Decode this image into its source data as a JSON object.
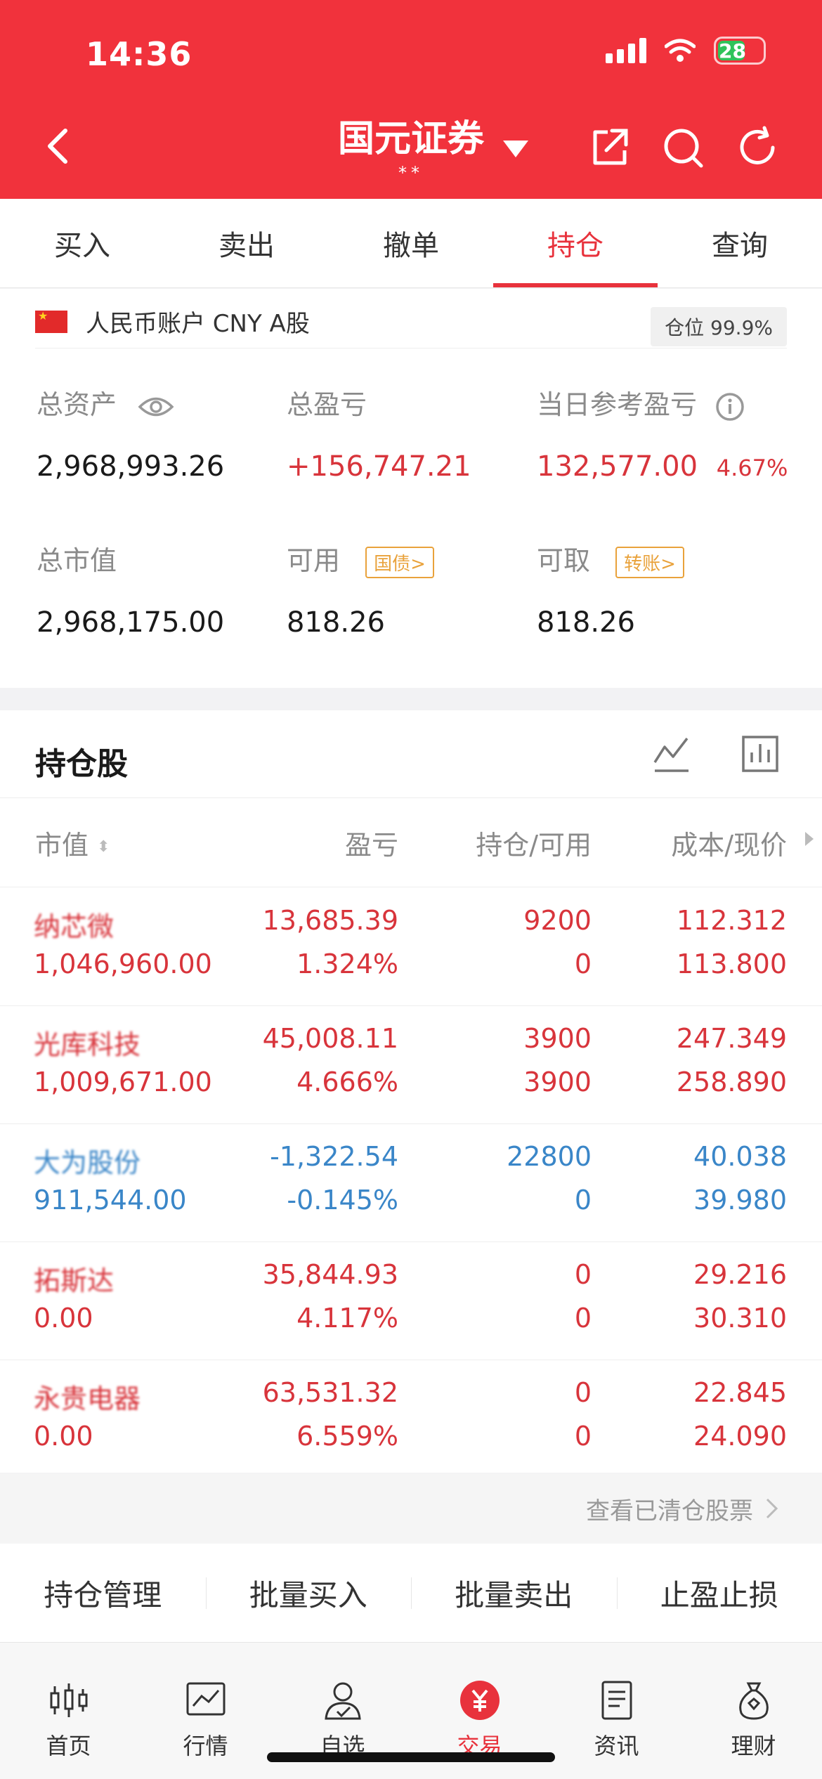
{
  "status": {
    "time": "14:36",
    "battery": "28"
  },
  "header": {
    "title": "国元证券",
    "subtitle": "**"
  },
  "tabs": [
    "买入",
    "卖出",
    "撤单",
    "持仓",
    "查询"
  ],
  "account": {
    "label": "人民币账户 CNY A股",
    "position_label": "仓位",
    "position_value": "99.9%"
  },
  "metrics": {
    "total_assets_label": "总资产",
    "total_assets": "2,968,993.26",
    "total_pl_label": "总盈亏",
    "total_pl": "+156,747.21",
    "daily_pl_label": "当日参考盈亏",
    "daily_pl": "132,577.00",
    "daily_pl_pct": "4.67%",
    "market_value_label": "总市值",
    "market_value": "2,968,175.00",
    "available_label": "可用",
    "available_badge": "国债>",
    "available": "818.26",
    "withdrawable_label": "可取",
    "withdrawable_badge": "转账>",
    "withdrawable": "818.26"
  },
  "holdings": {
    "title": "持仓股",
    "headers": {
      "market_value": "市值",
      "pl": "盈亏",
      "position": "持仓/可用",
      "cost": "成本/现价"
    },
    "rows": [
      {
        "name": "纳芯微",
        "market_value": "1,046,960.00",
        "pl": "13,685.39",
        "pl_pct": "1.324%",
        "position": "9200",
        "available": "0",
        "cost": "112.312",
        "price": "113.800",
        "color": "red"
      },
      {
        "name": "光库科技",
        "market_value": "1,009,671.00",
        "pl": "45,008.11",
        "pl_pct": "4.666%",
        "position": "3900",
        "available": "3900",
        "cost": "247.349",
        "price": "258.890",
        "color": "red"
      },
      {
        "name": "大为股份",
        "market_value": "911,544.00",
        "pl": "-1,322.54",
        "pl_pct": "-0.145%",
        "position": "22800",
        "available": "0",
        "cost": "40.038",
        "price": "39.980",
        "color": "blue"
      },
      {
        "name": "拓斯达",
        "market_value": "0.00",
        "pl": "35,844.93",
        "pl_pct": "4.117%",
        "position": "0",
        "available": "0",
        "cost": "29.216",
        "price": "30.310",
        "color": "red"
      },
      {
        "name": "永贵电器",
        "market_value": "0.00",
        "pl": "63,531.32",
        "pl_pct": "6.559%",
        "position": "0",
        "available": "0",
        "cost": "22.845",
        "price": "24.090",
        "color": "red"
      }
    ]
  },
  "cleared_link": "查看已清仓股票",
  "actions": [
    "持仓管理",
    "批量买入",
    "批量卖出",
    "止盈止损"
  ],
  "nav": [
    {
      "label": "首页",
      "icon": "candlestick-icon"
    },
    {
      "label": "行情",
      "icon": "chart-icon"
    },
    {
      "label": "自选",
      "icon": "user-check-icon"
    },
    {
      "label": "交易",
      "icon": "yuan-icon"
    },
    {
      "label": "资讯",
      "icon": "document-icon"
    },
    {
      "label": "理财",
      "icon": "money-bag-icon"
    }
  ],
  "colors": {
    "brand_red": "#f1323c",
    "gain_red": "#d8343b",
    "loss_blue": "#3a86c8",
    "badge_orange": "#e9a23b"
  }
}
